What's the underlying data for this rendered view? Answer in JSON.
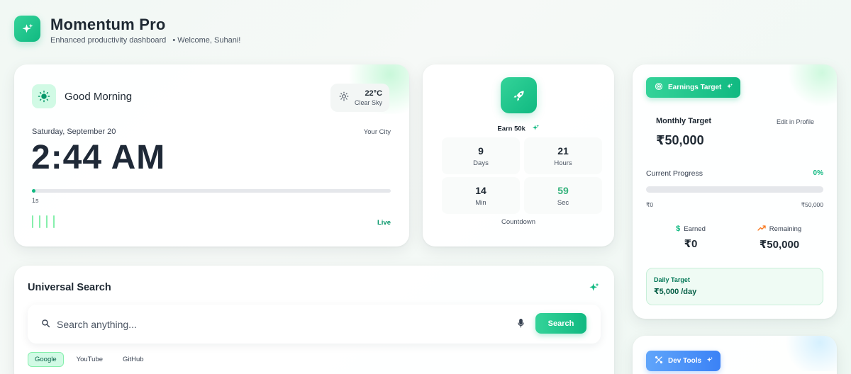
{
  "header": {
    "title": "Momentum Pro",
    "subtitle": "Enhanced productivity dashboard",
    "welcome": "• Welcome, Suhani!"
  },
  "clock": {
    "greeting": "Good Morning",
    "temperature": "22°C",
    "sky": "Clear Sky",
    "date": "Saturday, September 20",
    "city": "Your City",
    "time": "2:44 AM",
    "seconds_label": "1s",
    "live_label": "Live"
  },
  "countdown": {
    "goal_label": "Earn 50k",
    "cells": [
      {
        "value": "9",
        "label": "Days"
      },
      {
        "value": "21",
        "label": "Hours"
      },
      {
        "value": "14",
        "label": "Min"
      },
      {
        "value": "59",
        "label": "Sec"
      }
    ],
    "caption": "Countdown"
  },
  "earnings": {
    "badge": "Earnings Target",
    "monthly_label": "Monthly Target",
    "edit_link": "Edit in Profile",
    "monthly_value": "₹50,000",
    "progress_label": "Current Progress",
    "progress_pct": "0%",
    "progress_fraction": 0,
    "range_min": "₹0",
    "range_max": "₹50,000",
    "earned_label": "Earned",
    "earned_value": "₹0",
    "remaining_label": "Remaining",
    "remaining_value": "₹50,000",
    "daily_label": "Daily Target",
    "daily_value": "₹5,000 /day"
  },
  "devtools": {
    "badge": "Dev Tools"
  },
  "search": {
    "title": "Universal Search",
    "placeholder": "Search anything...",
    "button": "Search",
    "engines": [
      "Google",
      "YouTube",
      "GitHub"
    ],
    "active_engine": "Google"
  },
  "icons": {
    "logo": "sparkles-icon",
    "greeting": "sun-icon",
    "weather": "sun-icon",
    "countdown": "rocket-icon",
    "earnings_badge": "target-icon",
    "earned": "dollar-icon",
    "remaining": "trending-up-icon",
    "devtools_badge": "tools-icon",
    "search": "search-icon",
    "mic": "microphone-icon"
  },
  "colors": {
    "accent": "#10b981",
    "accent_light": "#34d399",
    "blue": "#3b82f6",
    "text": "#1f2933"
  }
}
